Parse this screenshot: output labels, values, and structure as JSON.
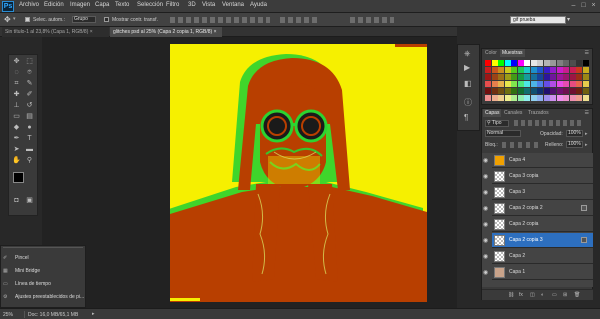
{
  "app": {
    "logo": "Ps"
  },
  "menu": [
    "Archivo",
    "Edición",
    "Imagen",
    "Capa",
    "Texto",
    "Selección",
    "Filtro",
    "3D",
    "Vista",
    "Ventana",
    "Ayuda"
  ],
  "options_bar": {
    "auto_select_label": "Selec. autom.:",
    "auto_select_value": "Grupo",
    "transform_label": "Mostrar contr. transf.",
    "search_value": "gif prueba"
  },
  "doc_tabs": [
    {
      "label": "Sin título-1 al 23,8% (Capa 1, RGB/8) ×"
    },
    {
      "label": "glitches psd al 25% (Capa 2 copia 1, RGB/8) ×"
    }
  ],
  "swatches_panel": {
    "tabs": [
      "Color",
      "Muestras"
    ]
  },
  "layers_panel": {
    "tabs": [
      "Capas",
      "Canales",
      "Trazados"
    ],
    "kind_filter": "Tipo",
    "blend_mode": "Normal",
    "opacity_label": "Opacidad:",
    "opacity_value": "100%",
    "lock_label": "Bloq.:",
    "fill_label": "Relleno:",
    "fill_value": "100%",
    "layers": [
      {
        "name": "Capa 4"
      },
      {
        "name": "Capa 3 copia"
      },
      {
        "name": "Capa 3"
      },
      {
        "name": "Capa 2 copia 2"
      },
      {
        "name": "Capa 2 copia"
      },
      {
        "name": "Capa 2 copia 3"
      },
      {
        "name": "Capa 2"
      },
      {
        "name": "Capa 1"
      }
    ]
  },
  "mini_panel": {
    "items": [
      "Pincel",
      "Mini Bridge",
      "Línea de tiempo",
      "Ajustes preestablecidos de pi..."
    ]
  },
  "status": {
    "zoom": "25%",
    "doc_info": "Doc: 16,0 MB/65,1 MB"
  },
  "colors": {
    "canvas_yellow": "#f6f000",
    "figure_red": "#b83f00",
    "glitch_green": "#2cd330",
    "accent_blue": "#2d6fbf"
  }
}
